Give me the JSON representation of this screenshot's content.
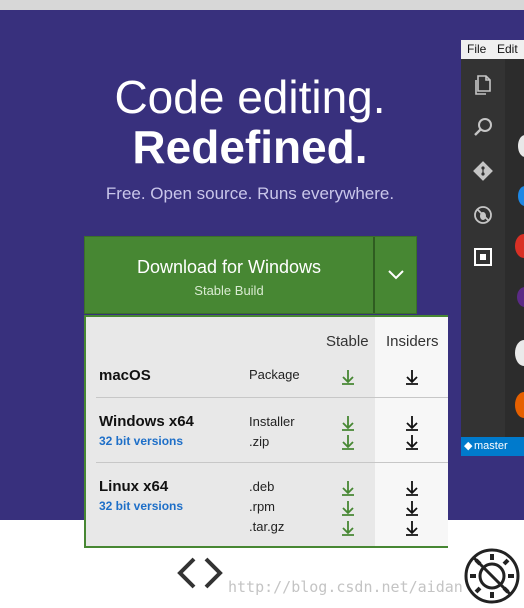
{
  "hero": {
    "headline_1": "Code editing.",
    "headline_2": "Redefined.",
    "tagline": "Free. Open source. Runs everywhere."
  },
  "download": {
    "title": "Download for Windows",
    "subtitle": "Stable Build",
    "toggle_icon": "chevron-down-icon"
  },
  "panel": {
    "col_stable": "Stable",
    "col_insiders": "Insiders",
    "rows": [
      {
        "os": "macOS",
        "sub": "",
        "formats": [
          "Package"
        ]
      },
      {
        "os": "Windows x64",
        "sub": "32 bit versions",
        "formats": [
          "Installer",
          ".zip"
        ]
      },
      {
        "os": "Linux x64",
        "sub": "32 bit versions",
        "formats": [
          ".deb",
          ".rpm",
          ".tar.gz"
        ]
      }
    ]
  },
  "editor": {
    "menu": [
      "File",
      "Edit"
    ],
    "status_branch": "master",
    "activity_icons": [
      "files-icon",
      "search-icon",
      "git-icon",
      "debug-icon",
      "extensions-icon"
    ]
  },
  "watermark": "http://blog.csdn.net/aidan",
  "colors": {
    "hero_bg": "#38307d",
    "download_green": "#478733",
    "stable_arrow": "#478733",
    "insiders_arrow": "#111111",
    "link_blue": "#1e6fc8",
    "status_blue": "#007acc"
  }
}
